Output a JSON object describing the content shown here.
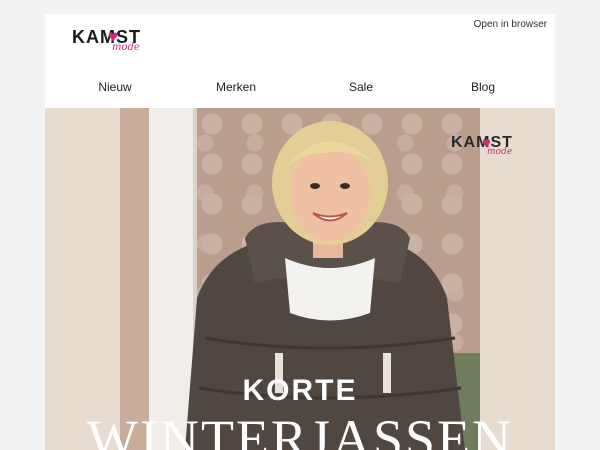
{
  "header": {
    "logo_text": "KAMST",
    "logo_heart": "♥",
    "logo_sub": "mode",
    "open_in_browser": "Open in browser"
  },
  "nav": {
    "items": [
      {
        "label": "Nieuw"
      },
      {
        "label": "Merken"
      },
      {
        "label": "Sale"
      },
      {
        "label": "Blog"
      }
    ]
  },
  "hero": {
    "logo_text": "KAMST",
    "logo_heart": "♥",
    "logo_sub": "mode",
    "headline_line1": "KORTE",
    "headline_line2": "WINTERJASSEN"
  },
  "colors": {
    "brand_pink": "#d12a7b",
    "background": "#f3f3f3",
    "hero_beige": "#e7dccf"
  }
}
